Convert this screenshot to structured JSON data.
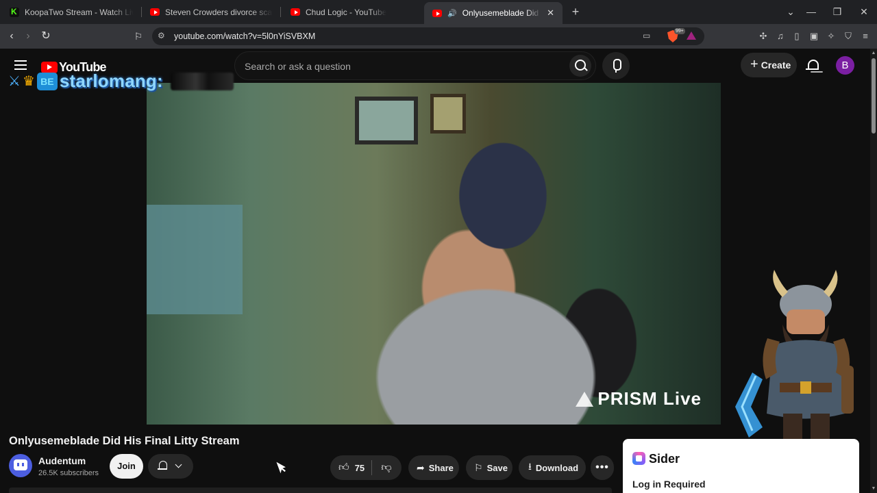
{
  "browser": {
    "tabs": [
      {
        "title": "KoopaTwo Stream - Watch Live o",
        "favicon": "kick-icon",
        "active": false
      },
      {
        "title": "Steven Crowders divorce scandal | RE",
        "favicon": "youtube-icon",
        "active": false
      },
      {
        "title": "Chud Logic - YouTube",
        "favicon": "youtube-icon",
        "active": false
      },
      {
        "title": "Onlyusemeblade Did His Final",
        "favicon": "youtube-icon",
        "active": true
      }
    ],
    "url": "youtube.com/watch?v=5l0nYiSVBXM",
    "brave_badge": "99+",
    "window_controls": {
      "dropdown": "⌄",
      "minimize": "—",
      "maximize": "❐",
      "close": "✕"
    }
  },
  "youtube": {
    "logo_text": "YouTube",
    "search_placeholder": "Search or ask a question",
    "create_label": "Create",
    "avatar_letter": "B"
  },
  "overlay": {
    "username": "starlomang:",
    "badge_text": "BE"
  },
  "video": {
    "watermark": "PRISM Live",
    "title": "Onlyusemeblade Did His Final Litty Stream"
  },
  "channel": {
    "name": "Audentum",
    "subscribers": "26.5K subscribers",
    "join_label": "Join"
  },
  "actions": {
    "likes": "75",
    "share_label": "Share",
    "save_label": "Save",
    "download_label": "Download",
    "more_label": "•••"
  },
  "sider": {
    "name": "Sider",
    "login_text": "Log in Required"
  },
  "colors": {
    "page_bg": "#0f0f0f",
    "pill_bg": "#272727",
    "yt_red": "#ff0000",
    "avatar_purple": "#7b1fa2"
  }
}
